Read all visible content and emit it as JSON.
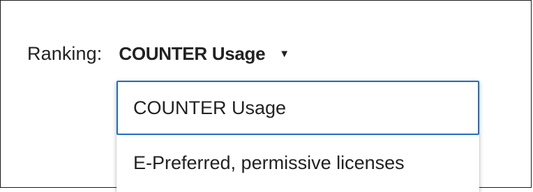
{
  "ranking": {
    "label": "Ranking:",
    "selected_value": "COUNTER Usage",
    "caret_icon": "triangle-down-icon",
    "options": [
      {
        "label": "COUNTER Usage",
        "highlighted": true
      },
      {
        "label": "E-Preferred, permissive licenses",
        "highlighted": false
      }
    ]
  },
  "colors": {
    "text": "#222222",
    "focus_border": "#1e6fcc",
    "background": "#ffffff"
  }
}
